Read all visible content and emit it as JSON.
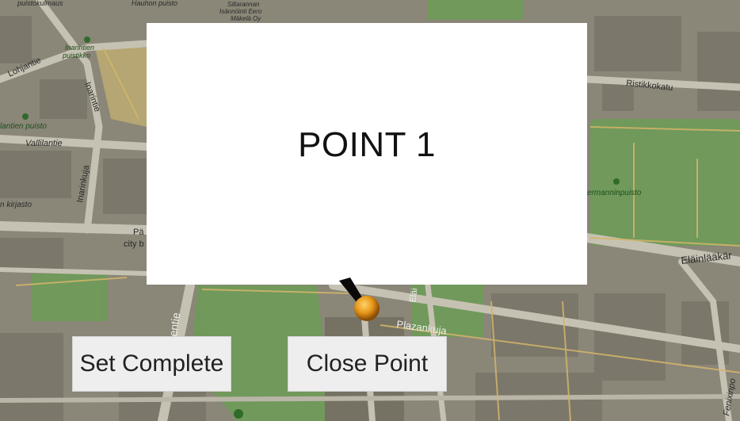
{
  "map": {
    "labels": {
      "puistokulmaus": "puistokulmaus",
      "hauhon_puisto": "Hauhon puisto",
      "siltarannan": "Siltarannan",
      "isannointi": "Isännöinti Eero",
      "makela": "Mäkelä Oy",
      "inarintien": "Inarintien",
      "puistikko": "puistikko",
      "lohjantie": "Lohjantie",
      "inarintie": "Inarintie",
      "ristikkokatu": "Ristikkokatu",
      "lantien_puisto": "lantien puisto",
      "vallilantie": "Vallilantie",
      "inarinkuja": "Inarinkuja",
      "kirjasto": "n kirjasto",
      "hermanninpuisto": "ermanninpuisto",
      "pa": "Pä",
      "city_b": "city b",
      "elainlaakari": "Eläinlääkär",
      "entie": "entie",
      "elai": "Eläi",
      "plazankuja": "Plazankuja",
      "fenixinpolku": "Fenixinpo"
    },
    "colors": {
      "background": "#8a8678",
      "park": "#6f9a5a",
      "road": "#c9c6b8",
      "building": "#7d796c",
      "road_outline": "#d3b56a"
    }
  },
  "popup": {
    "title": "POINT 1"
  },
  "buttons": {
    "set_complete": "Set Complete",
    "close_point": "Close Point"
  },
  "marker": {
    "icon": "map-pin-icon",
    "color": "#e8981a"
  }
}
